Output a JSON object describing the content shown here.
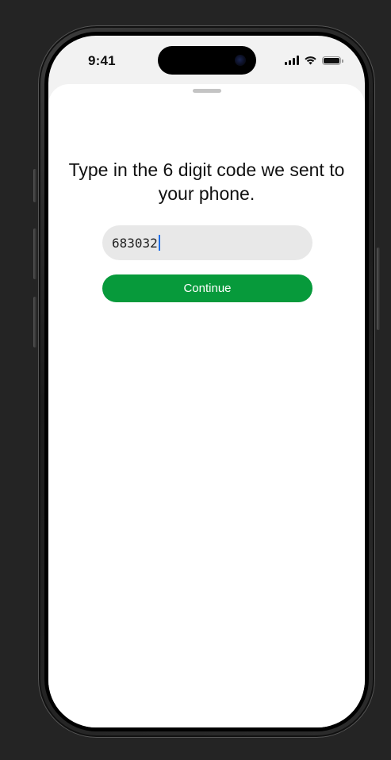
{
  "status_bar": {
    "time": "9:41"
  },
  "screen": {
    "prompt": "Type in the 6 digit code we sent to your phone.",
    "code_input": {
      "value": "683032"
    },
    "continue_button": {
      "label": "Continue"
    }
  },
  "colors": {
    "accent": "#079a3b",
    "input_background": "#e8e8e8",
    "caret": "#1f6fe8"
  },
  "icons": [
    "cellular-signal-icon",
    "wifi-icon",
    "battery-icon"
  ]
}
